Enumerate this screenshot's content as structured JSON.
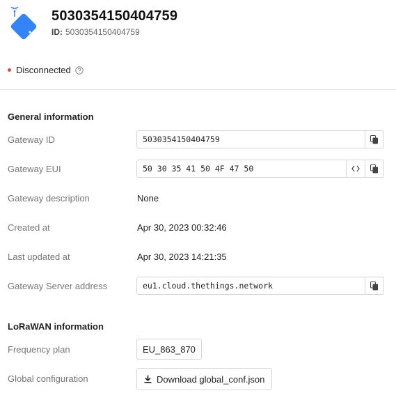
{
  "gateway": {
    "title": "5030354150404759",
    "id_label": "ID:",
    "id_value": "5030354150404759"
  },
  "status": {
    "text": "Disconnected",
    "color": "#e0473a"
  },
  "general": {
    "section_title": "General information",
    "rows": [
      {
        "label": "Gateway ID",
        "value": "5030354150404759"
      },
      {
        "label": "Gateway EUI",
        "value": "50 30 35 41 50 4F 47 50"
      },
      {
        "label": "Gateway description",
        "value": "None"
      },
      {
        "label": "Created at",
        "value": "Apr 30, 2023 00:32:46"
      },
      {
        "label": "Last updated at",
        "value": "Apr 30, 2023 14:21:35"
      },
      {
        "label": "Gateway Server address",
        "value": "eu1.cloud.thethings.network"
      }
    ]
  },
  "lorawan": {
    "section_title": "LoRaWAN information",
    "frequency_label": "Frequency plan",
    "frequency_value": "EU_863_870",
    "global_config_label": "Global configuration",
    "download_label": "Download global_conf.json"
  },
  "colors": {
    "accent": "#2d6ee6",
    "status_disconnected": "#e0473a"
  }
}
